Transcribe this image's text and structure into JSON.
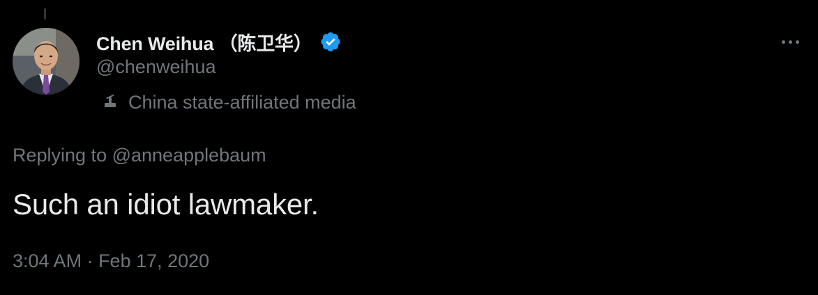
{
  "author": {
    "display_name": "Chen Weihua （陈卫华）",
    "handle": "@chenweihua",
    "verified": true,
    "avatar_icon": "person-avatar",
    "label": {
      "icon": "microphone-icon",
      "text": "China state-affiliated media"
    }
  },
  "reply": {
    "prefix": "Replying to ",
    "mention": "@anneapplebaum"
  },
  "tweet": {
    "text": "Such an idiot lawmaker."
  },
  "meta": {
    "time": "3:04 AM",
    "separator": " · ",
    "date": "Feb 17, 2020"
  },
  "colors": {
    "background": "#000000",
    "primary_text": "#e7e9ea",
    "secondary_text": "#71767b",
    "verified_blue": "#1d9bf0"
  }
}
